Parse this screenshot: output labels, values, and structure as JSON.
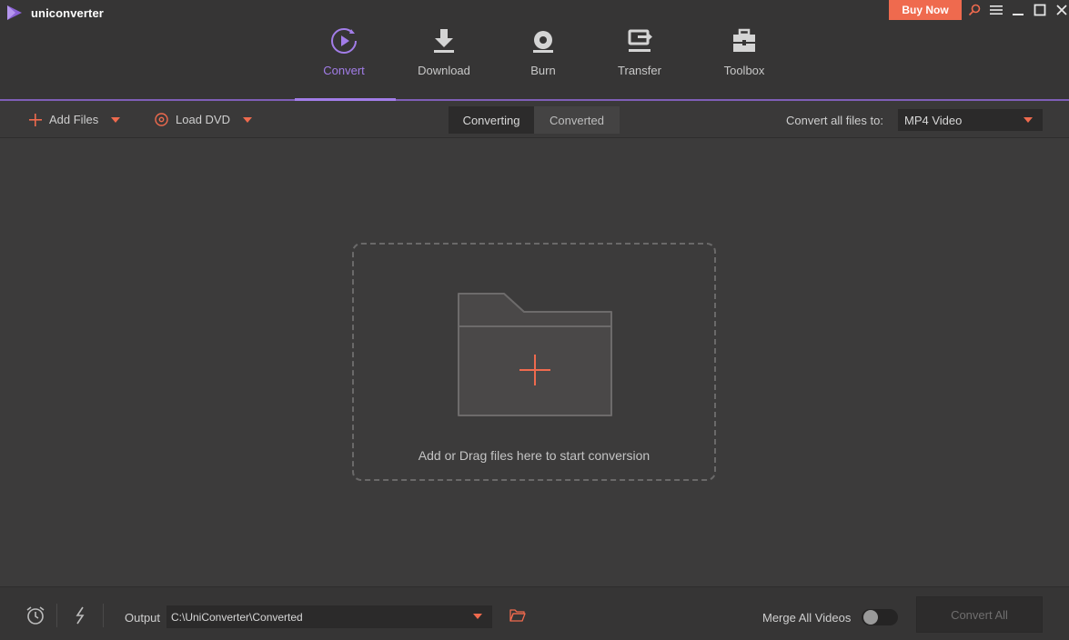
{
  "app": {
    "title": "uniconverter"
  },
  "colors": {
    "accent": "#a27de8",
    "buy_now": "#ef6a4e",
    "plus": "#ef6a4e"
  },
  "topbar": {
    "buy_now": "Buy Now",
    "nav": [
      {
        "label": "Convert",
        "icon": "convert-icon",
        "active": true
      },
      {
        "label": "Download",
        "icon": "download-icon",
        "active": false
      },
      {
        "label": "Burn",
        "icon": "burn-icon",
        "active": false
      },
      {
        "label": "Transfer",
        "icon": "transfer-icon",
        "active": false
      },
      {
        "label": "Toolbox",
        "icon": "toolbox-icon",
        "active": false
      }
    ]
  },
  "toolbar": {
    "add_files": "Add Files",
    "load_dvd": "Load DVD",
    "tabs": [
      {
        "label": "Converting",
        "active": true
      },
      {
        "label": "Converted",
        "active": false
      }
    ],
    "convert_all_to_label": "Convert all files to:",
    "format_value": "MP4 Video"
  },
  "main": {
    "drop_text": "Add or Drag files here to start conversion"
  },
  "bottombar": {
    "output_label": "Output",
    "output_path": "C:\\UniConverter\\Converted",
    "merge_label": "Merge All Videos",
    "merge_enabled": false,
    "convert_all": "Convert All"
  }
}
